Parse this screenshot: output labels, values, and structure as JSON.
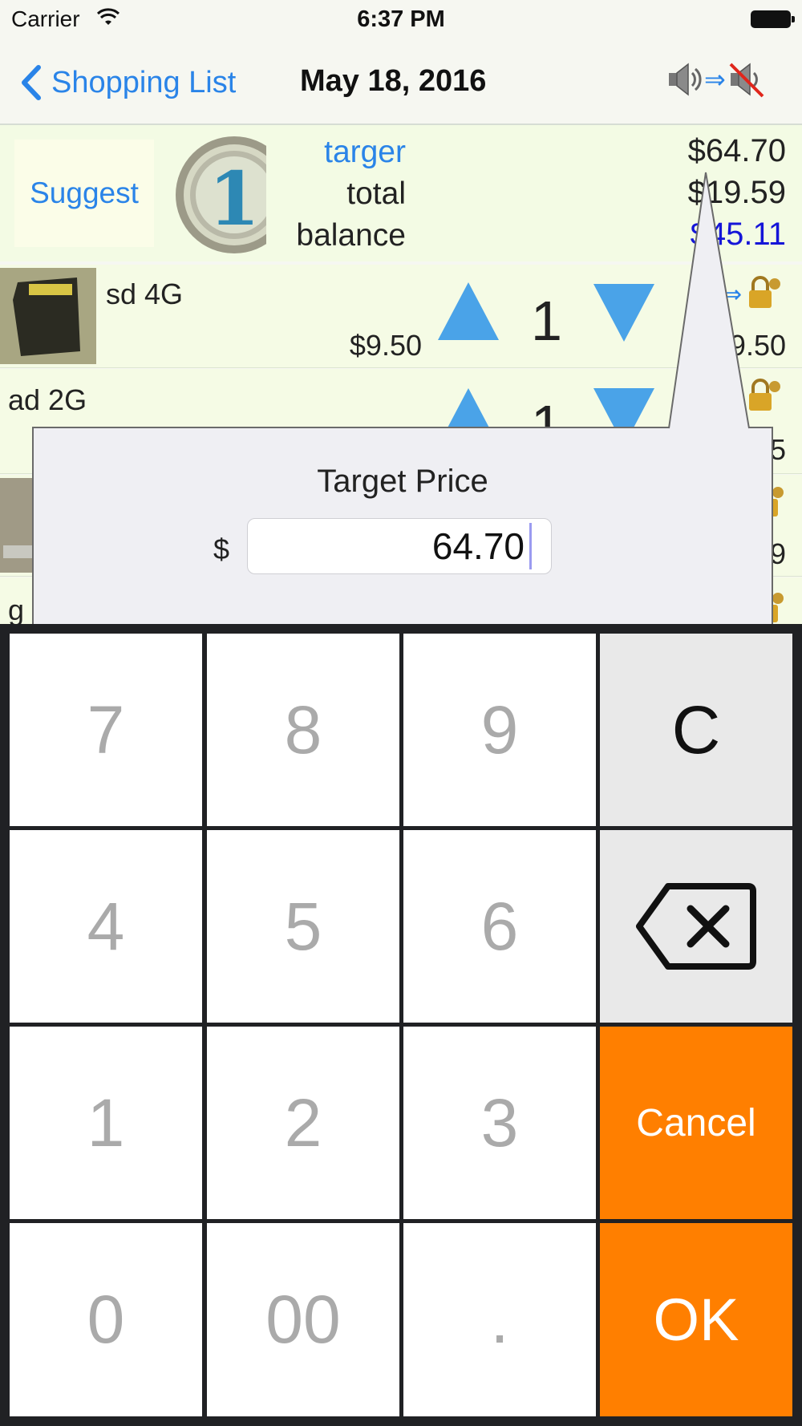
{
  "status_bar": {
    "carrier": "Carrier",
    "time": "6:37 PM"
  },
  "nav": {
    "back_label": "Shopping List",
    "date": "May 18, 2016",
    "arrow": "⇒",
    "sound_on_icon": "speaker-icon",
    "sound_off_icon": "speaker-muted-icon"
  },
  "summary": {
    "suggest_label": "Suggest",
    "coin_icon": "coin-one-icon",
    "target_label": "targer",
    "total_label": "total",
    "balance_label": "balance",
    "target_value": "$64.70",
    "total_value": "$19.59",
    "balance_value": "$45.11"
  },
  "rows": [
    {
      "name": "sd 4G",
      "price": "$9.50",
      "qty": "1",
      "subtotal": "$9.50",
      "arrow": "⇒"
    },
    {
      "name": "ad 2G",
      "qty": "1",
      "subtotal_partial": "5"
    },
    {
      "subtotal_partial": "9"
    },
    {
      "name_partial": "g"
    }
  ],
  "popover": {
    "title": "Target Price",
    "currency": "$",
    "value": "64.70"
  },
  "keypad": {
    "keys": [
      "7",
      "8",
      "9",
      "4",
      "5",
      "6",
      "1",
      "2",
      "3",
      "0",
      "00",
      "."
    ],
    "clear_label": "C",
    "cancel_label": "Cancel",
    "ok_label": "OK",
    "backspace_icon": "backspace-icon"
  },
  "colors": {
    "accent_blue": "#2a84e8",
    "balance_blue": "#1515d8",
    "orange": "#ff7f00",
    "triangle_blue": "#4aa3e8"
  }
}
